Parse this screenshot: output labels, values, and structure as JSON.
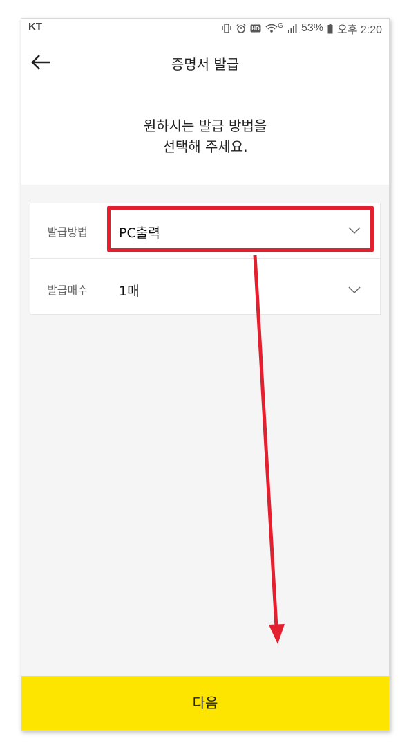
{
  "status_bar": {
    "carrier": "KT",
    "network": "G",
    "battery": "53%",
    "time": "오후 2:20"
  },
  "header": {
    "title": "증명서 발급",
    "back_icon": "back-arrow-icon"
  },
  "intro": {
    "line1": "원하시는 발급 방법을",
    "line2": "선택해 주세요."
  },
  "form": {
    "rows": [
      {
        "label": "발급방법",
        "value": "PC출력",
        "icon": "chevron-down-icon"
      },
      {
        "label": "발급매수",
        "value": "1매",
        "icon": "chevron-down-icon"
      }
    ]
  },
  "footer": {
    "next_label": "다음"
  },
  "colors": {
    "accent": "#fee500",
    "annotation": "#e2202f",
    "background": "#f5f5f5"
  }
}
